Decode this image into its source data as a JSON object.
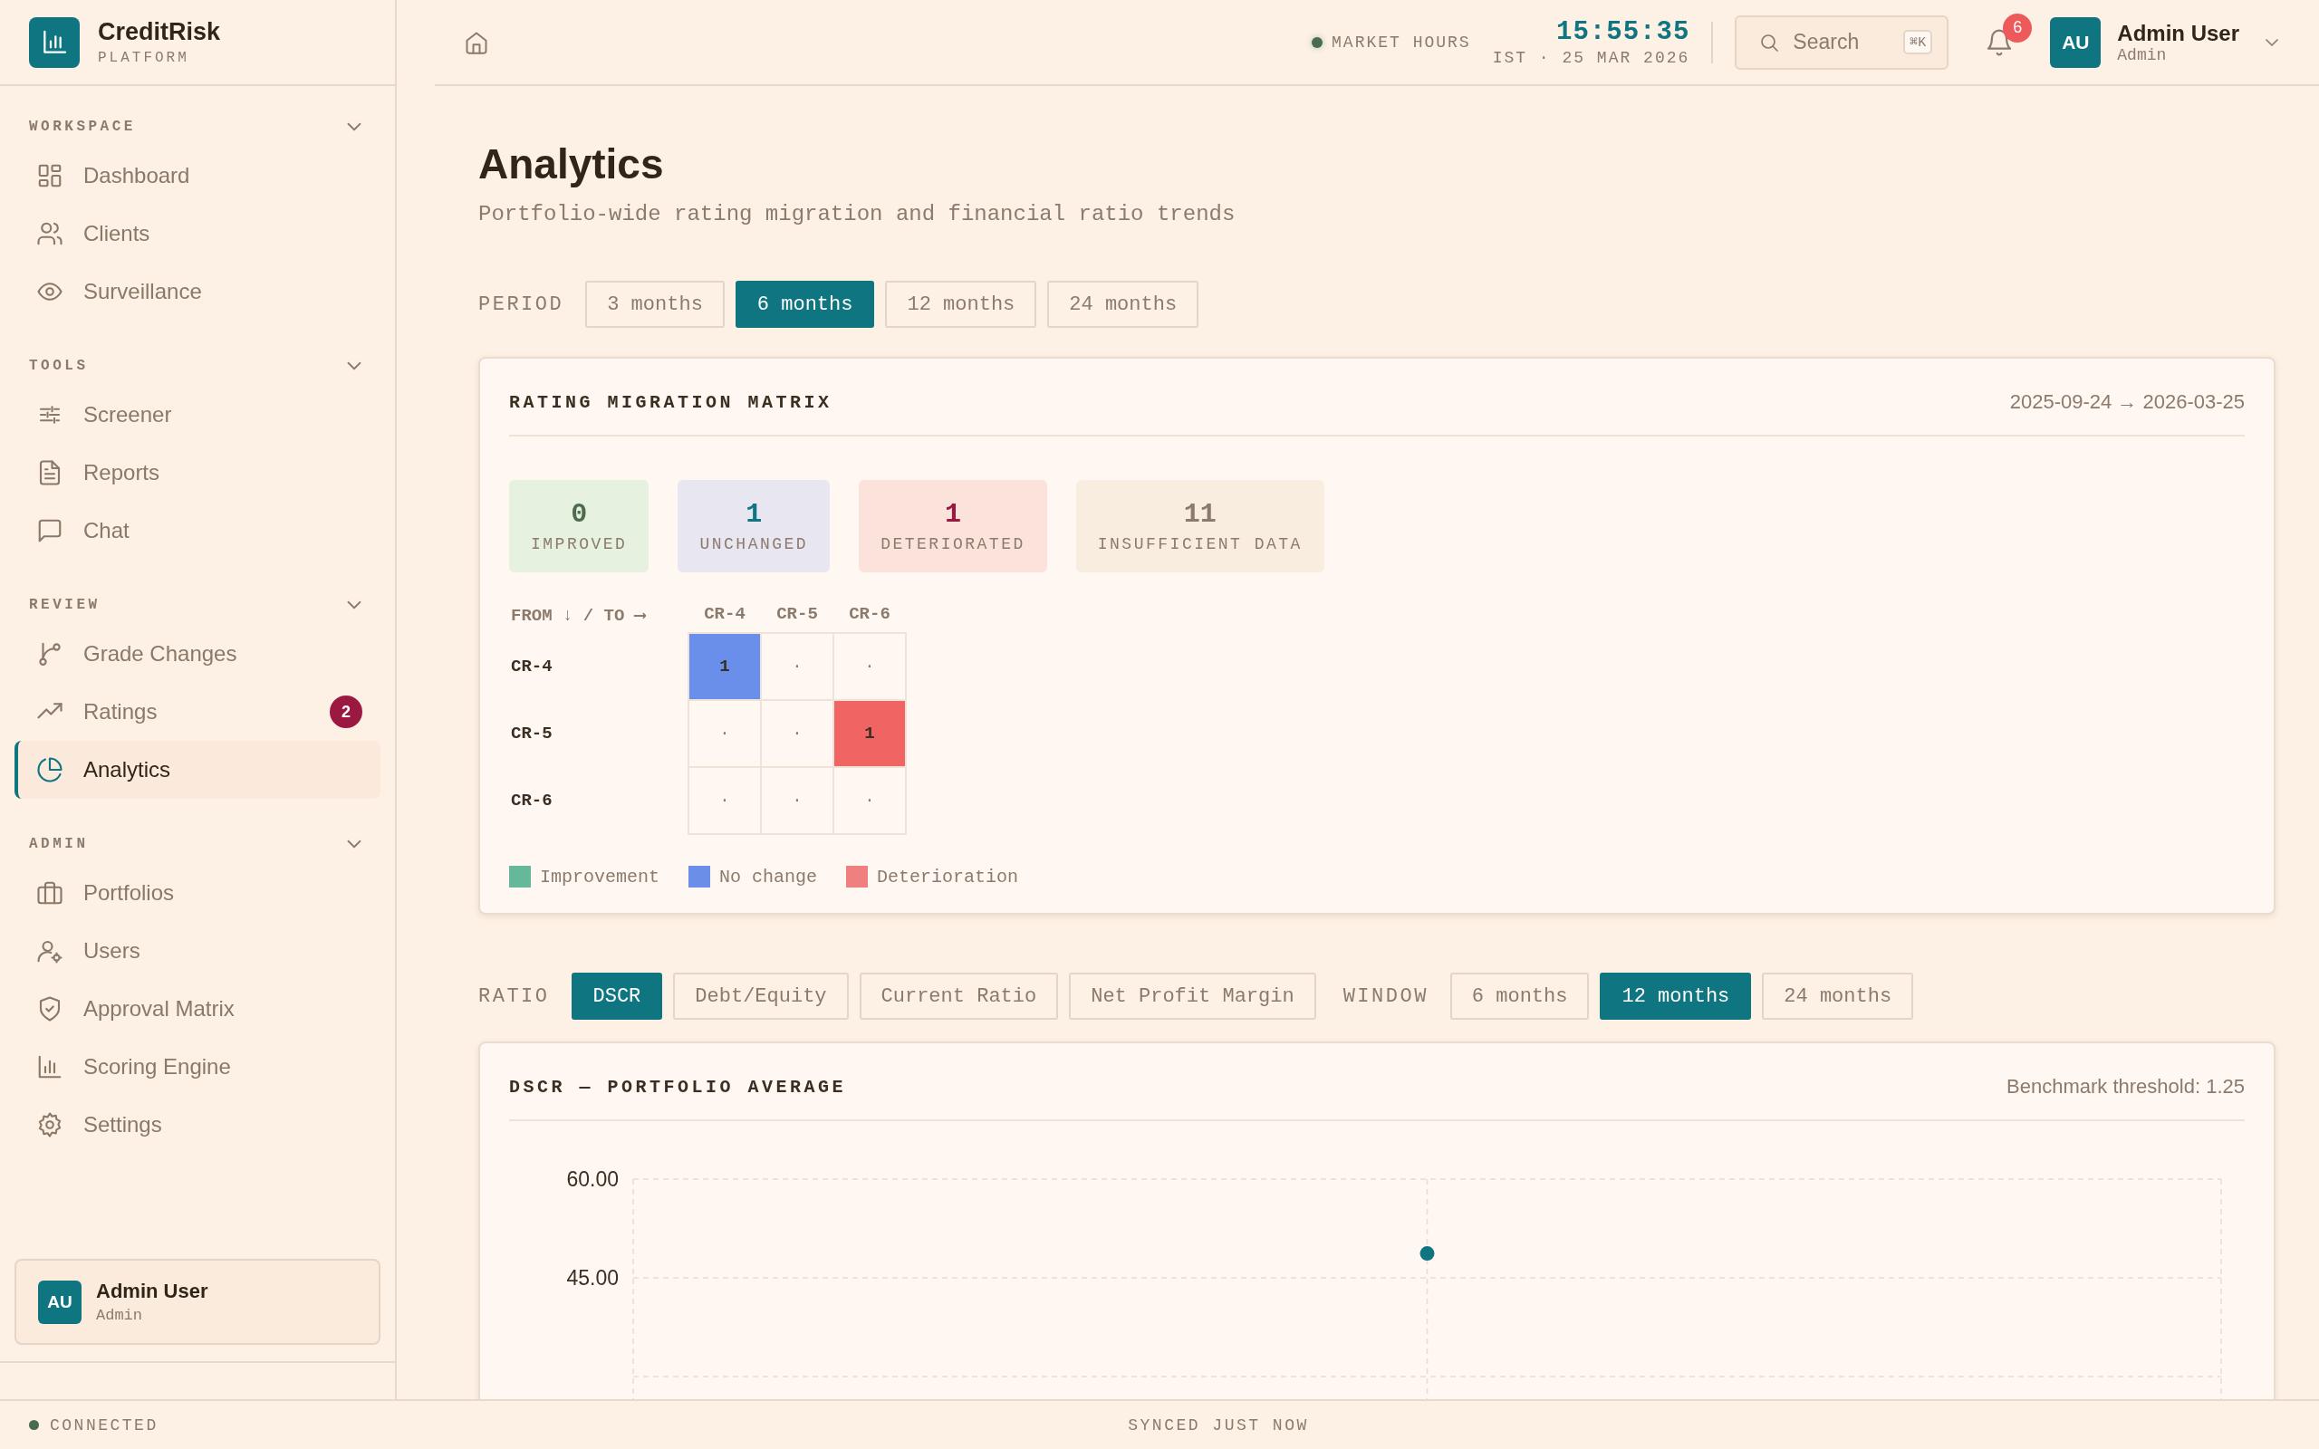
{
  "sidebar": {
    "brand": {
      "name": "CreditRisk",
      "tagline": "PLATFORM"
    },
    "sections": [
      {
        "title": "WORKSPACE",
        "expanded": true,
        "items": [
          {
            "label": "Dashboard",
            "selected": false
          },
          {
            "label": "Clients",
            "selected": false
          },
          {
            "label": "Surveillance",
            "selected": false
          }
        ]
      },
      {
        "title": "TOOLS",
        "expanded": true,
        "items": [
          {
            "label": "Screener",
            "selected": false
          },
          {
            "label": "Reports",
            "selected": false
          },
          {
            "label": "Chat",
            "selected": false
          }
        ]
      },
      {
        "title": "REVIEW",
        "expanded": true,
        "items": [
          {
            "label": "Grade Changes",
            "selected": false
          },
          {
            "label": "Ratings",
            "selected": false,
            "badge": "2"
          },
          {
            "label": "Analytics",
            "selected": true
          }
        ]
      },
      {
        "title": "ADMIN",
        "expanded": true,
        "items": [
          {
            "label": "Portfolios",
            "selected": false
          },
          {
            "label": "Users",
            "selected": false
          },
          {
            "label": "Approval Matrix",
            "selected": false
          },
          {
            "label": "Scoring Engine",
            "selected": false
          },
          {
            "label": "Settings",
            "selected": false
          }
        ]
      }
    ],
    "user": {
      "initials": "AU",
      "name": "Admin User",
      "role": "Admin"
    }
  },
  "topbar": {
    "market": "MARKET HOURS",
    "clock": {
      "time": "15:55:35",
      "date": "IST · 25 MAR 2026"
    },
    "search": {
      "placeholder": "Search",
      "shortcut": "⌘K"
    },
    "notifications": "6",
    "user": {
      "initials": "AU",
      "name": "Admin User",
      "role": "Admin"
    }
  },
  "page": {
    "title": "Analytics",
    "subtitle": "Portfolio-wide rating migration and financial ratio trends"
  },
  "period": {
    "label": "PERIOD",
    "options": [
      {
        "label": "3 months",
        "selected": false
      },
      {
        "label": "6 months",
        "selected": true
      },
      {
        "label": "12 months",
        "selected": false
      },
      {
        "label": "24 months",
        "selected": false
      }
    ]
  },
  "migration": {
    "title": "RATING MIGRATION MATRIX",
    "range": "2025-09-24 → 2026-03-25",
    "stats": [
      {
        "value": "0",
        "label": "IMPROVED",
        "kind": "improved"
      },
      {
        "value": "1",
        "label": "UNCHANGED",
        "kind": "unchanged"
      },
      {
        "value": "1",
        "label": "DETERIORATED",
        "kind": "deteriorated"
      },
      {
        "value": "11",
        "label": "INSUFFICIENT DATA",
        "kind": "insufficient"
      }
    ],
    "corner": "FROM ↓ / TO ⟶",
    "columns": [
      "CR-4",
      "CR-5",
      "CR-6"
    ],
    "rows": [
      {
        "label": "CR-4",
        "cells": [
          {
            "value": "1",
            "kind": "no_change"
          },
          {
            "value": "·",
            "kind": "empty"
          },
          {
            "value": "·",
            "kind": "empty"
          }
        ]
      },
      {
        "label": "CR-5",
        "cells": [
          {
            "value": "·",
            "kind": "empty"
          },
          {
            "value": "·",
            "kind": "empty"
          },
          {
            "value": "1",
            "kind": "deterioration"
          }
        ]
      },
      {
        "label": "CR-6",
        "cells": [
          {
            "value": "·",
            "kind": "empty"
          },
          {
            "value": "·",
            "kind": "empty"
          },
          {
            "value": "·",
            "kind": "empty"
          }
        ]
      }
    ],
    "legend": [
      {
        "label": "Improvement",
        "color": "#66b89b"
      },
      {
        "label": "No change",
        "color": "#6b8ee8"
      },
      {
        "label": "Deterioration",
        "color": "#f08080"
      }
    ]
  },
  "ratio_filters": {
    "ratio": {
      "label": "RATIO",
      "options": [
        {
          "label": "DSCR",
          "selected": true
        },
        {
          "label": "Debt/Equity",
          "selected": false
        },
        {
          "label": "Current Ratio",
          "selected": false
        },
        {
          "label": "Net Profit Margin",
          "selected": false
        }
      ]
    },
    "window": {
      "label": "WINDOW",
      "options": [
        {
          "label": "6 months",
          "selected": false
        },
        {
          "label": "12 months",
          "selected": true
        },
        {
          "label": "24 months",
          "selected": false
        }
      ]
    }
  },
  "ratio_chart": {
    "title": "DSCR — PORTFOLIO AVERAGE",
    "benchmark": "Benchmark threshold: 1.25",
    "chart_data": {
      "type": "scatter",
      "categories": [
        null,
        null,
        null
      ],
      "ylim": [
        30,
        60
      ],
      "yticks": [
        {
          "value": 60,
          "label": "60.00"
        },
        {
          "value": 45,
          "label": "45.00"
        }
      ],
      "series": [
        {
          "color": "#0f7580",
          "values": [
            null,
            48.7,
            null
          ]
        }
      ]
    }
  },
  "status_bar": {
    "connection": "CONNECTED",
    "sync": "SYNCED JUST NOW"
  }
}
